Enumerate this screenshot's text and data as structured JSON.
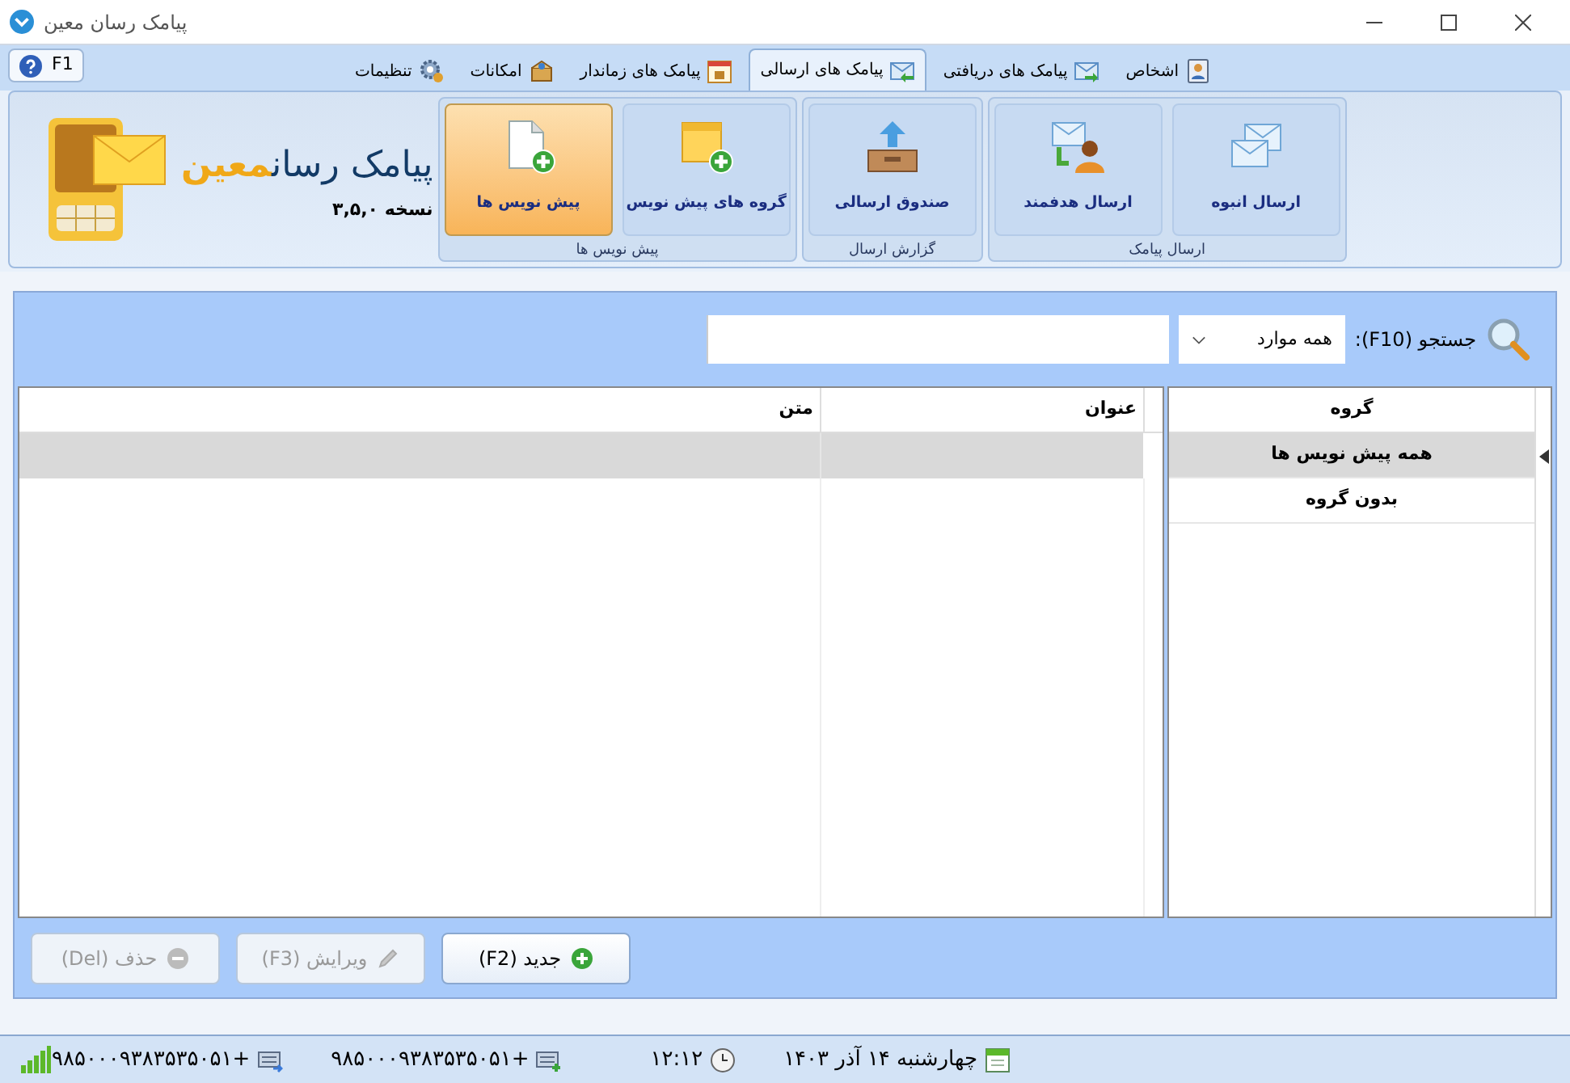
{
  "window": {
    "title": "پیامک رسان معین"
  },
  "help_button": {
    "label": "F1"
  },
  "tabs": [
    {
      "label": "اشخاص",
      "kind": "contacts",
      "selected": false
    },
    {
      "label": "پیامک های دریافتی",
      "kind": "inbox",
      "selected": false
    },
    {
      "label": "پیامک های ارسالی",
      "kind": "sent",
      "selected": true
    },
    {
      "label": "پیامک های زماندار",
      "kind": "calendar",
      "selected": false
    },
    {
      "label": "امکانات",
      "kind": "tools",
      "selected": false
    },
    {
      "label": "تنظیمات",
      "kind": "settings",
      "selected": false
    }
  ],
  "ribbon": {
    "groups": [
      {
        "title": "ارسال پیامک",
        "buttons": [
          {
            "label": "ارسال انبوه",
            "kind": "bulk",
            "selected": false
          },
          {
            "label": "ارسال هدفمند",
            "kind": "targeted",
            "selected": false
          }
        ]
      },
      {
        "title": "گزارش ارسال",
        "buttons": [
          {
            "label": "صندوق ارسالی",
            "kind": "outbox",
            "selected": false
          }
        ]
      },
      {
        "title": "پیش نویس ها",
        "buttons": [
          {
            "label": "گروه های پیش نویس",
            "kind": "draft-groups",
            "selected": false
          },
          {
            "label": "پیش نویس ها",
            "kind": "drafts",
            "selected": true
          }
        ]
      }
    ]
  },
  "logo": {
    "name": "پیامک رسان",
    "name_accent": "معین",
    "version": "نسخه ۳,۵,۰"
  },
  "search": {
    "label": "جستجو (F10):",
    "filter": "همه موارد"
  },
  "groups_table": {
    "columns": [
      "گروه"
    ],
    "rows": [
      {
        "name": "همه پیش نویس ها",
        "selected": true
      },
      {
        "name": "بدون گروه",
        "selected": false
      }
    ]
  },
  "drafts_table": {
    "columns": [
      "عنوان",
      "متن"
    ],
    "rows": [
      {
        "selected": true
      }
    ]
  },
  "actions": [
    {
      "label": "جدید (F2)",
      "kind": "new",
      "disabled": false
    },
    {
      "label": "ویرایش (F3)",
      "kind": "edit",
      "disabled": true
    },
    {
      "label": "حذف (Del)",
      "kind": "delete",
      "disabled": true
    }
  ],
  "status_bar": {
    "date": "چهارشنبه ۱۴ آذر ۱۴۰۳",
    "time": "۱۲:۱۲",
    "numbers": [
      {
        "text": "+۹۸۵۰۰۰۹۳۸۳۵۳۵۰۵۱",
        "kind": "receive"
      },
      {
        "text": "+۹۸۵۰۰۰۹۳۸۳۵۳۵۰۵۱",
        "kind": "send"
      }
    ]
  }
}
